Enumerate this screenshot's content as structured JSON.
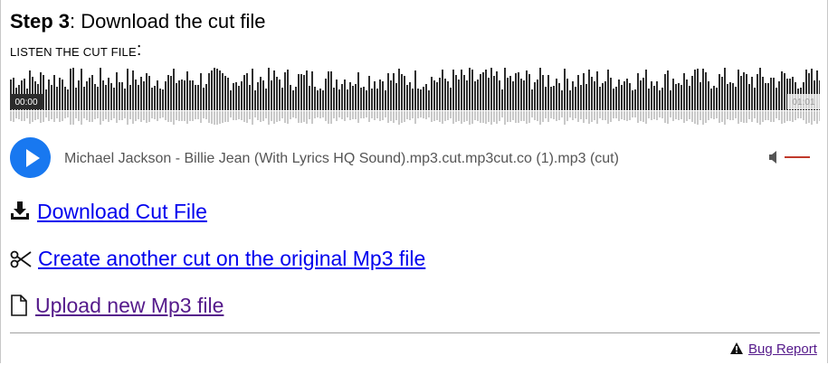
{
  "heading": {
    "step": "Step 3",
    "text": ": Download the cut file"
  },
  "listen": {
    "label": "LISTEN THE CUT FILE",
    "colon": ":"
  },
  "waveform": {
    "time_start": "00:00",
    "time_end": "01:01"
  },
  "player": {
    "track": "Michael Jackson - Billie Jean (With Lyrics HQ Sound).mp3.cut.mp3cut.co (1).mp3 (cut)",
    "accent": "#1878f0",
    "volume_color": "#c0392b"
  },
  "links": {
    "download": "Download Cut File",
    "another_cut": "Create another cut on the original Mp3 file",
    "upload": "Upload new Mp3 file"
  },
  "footer": {
    "bug_report": "Bug Report"
  }
}
